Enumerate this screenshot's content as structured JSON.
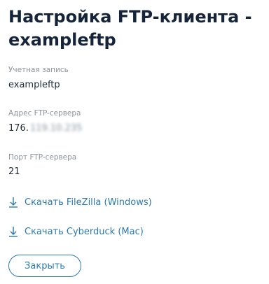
{
  "dialog": {
    "title": "Настройка FTP-клиента - exampleftp"
  },
  "fields": {
    "account": {
      "label": "Учетная запись",
      "value": "exampleftp"
    },
    "server": {
      "label": "Адрес FTP-сервера",
      "value_prefix": "176.",
      "value_hidden": "119.10.235"
    },
    "port": {
      "label": "Порт FTP-сервера",
      "value": "21"
    }
  },
  "links": {
    "filezilla": "Скачать FileZilla (Windows)",
    "cyberduck": "Скачать Cyberduck (Mac)",
    "icon": "download-arrow-icon",
    "color": "#2b7ab0"
  },
  "buttons": {
    "close": "Закрыть"
  }
}
